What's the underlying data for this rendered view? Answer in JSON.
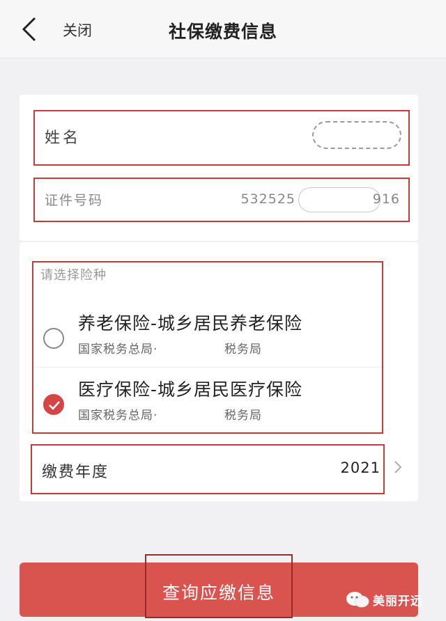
{
  "navbar": {
    "close_label": "关闭",
    "title": "社保缴费信息"
  },
  "form": {
    "name": {
      "label": "姓名"
    },
    "id_number": {
      "label": "证件号码",
      "value_prefix": "532525",
      "value_suffix": "916"
    },
    "insurance": {
      "hint": "请选择险种",
      "options": [
        {
          "title": "养老保险-城乡居民养老保险",
          "org": "国家税务总局·",
          "bureau": "税务局",
          "selected": false
        },
        {
          "title": "医疗保险-城乡居民医疗保险",
          "org": "国家税务总局·",
          "bureau": "税务局",
          "selected": true
        }
      ]
    },
    "year": {
      "label": "缴费年度",
      "value": "2021"
    }
  },
  "query_button": {
    "label": "查询应缴信息"
  },
  "watermark": {
    "text": "美丽开远"
  },
  "colors": {
    "accent": "#d9534f",
    "annotation_outline": "#c83a3a",
    "background": "#f1f1f3"
  },
  "icons": [
    "back-icon",
    "chevron-right-icon",
    "check-icon",
    "wechat-icon"
  ]
}
